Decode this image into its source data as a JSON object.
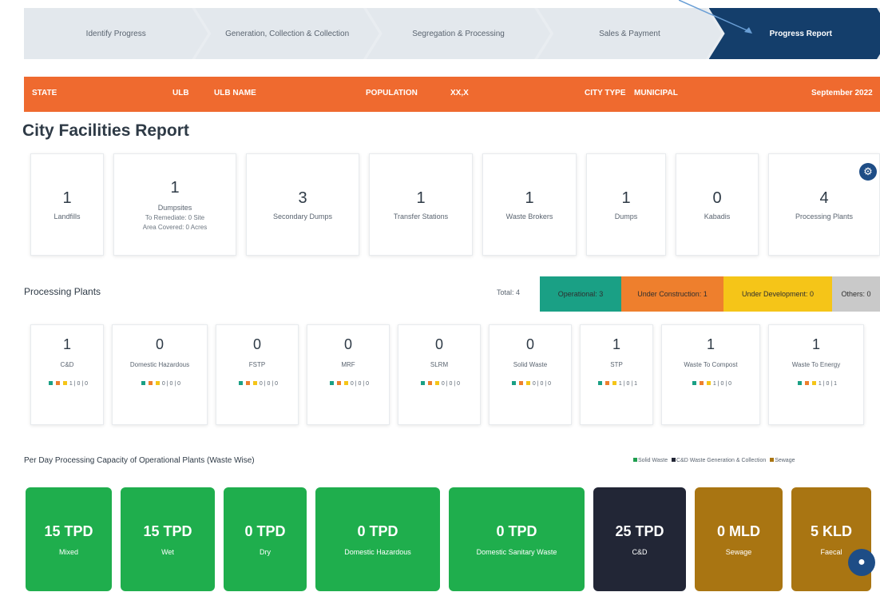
{
  "stepper": {
    "steps": [
      {
        "label": "Identify Progress"
      },
      {
        "label": "Generation, Collection & Collection"
      },
      {
        "label": "Segregation & Processing"
      },
      {
        "label": "Sales & Payment"
      },
      {
        "label": "Progress Report"
      }
    ],
    "active_index": 4
  },
  "banner": {
    "state": "STATE",
    "ulb_label": "ULB",
    "ulb_value": "ULB NAME",
    "population_label": "POPULATION",
    "population_value": "XX,X",
    "city_label": "CITY TYPE",
    "city_value": "MUNICIPAL",
    "month": "September 2022"
  },
  "page_title": "City Facilities Report",
  "facilities": [
    {
      "num": "1",
      "label": "Landfills"
    },
    {
      "num": "1",
      "label": "Dumpsites",
      "sub1": "To Remediate: 0 Site",
      "sub2": "Area Covered: 0 Acres"
    },
    {
      "num": "3",
      "label": "Secondary Dumps"
    },
    {
      "num": "1",
      "label": "Transfer Stations"
    },
    {
      "num": "1",
      "label": "Waste Brokers"
    },
    {
      "num": "1",
      "label": "Dumps"
    },
    {
      "num": "0",
      "label": "Kabadis"
    },
    {
      "num": "4",
      "label": "Processing Plants"
    }
  ],
  "gear_icon": "gear-icon",
  "processing": {
    "title": "Processing Plants",
    "total": "Total: 4",
    "filters": [
      {
        "label": "Operational: 3",
        "color": "#1aa085"
      },
      {
        "label": "Under Construction: 1",
        "color": "#ee7f2d"
      },
      {
        "label": "Under Development: 0",
        "color": "#f5c518"
      },
      {
        "label": "Others: 0",
        "color": "#c9c9c9"
      }
    ],
    "plants": [
      {
        "num": "1",
        "label": "C&D",
        "stat": "1 | 0 | 0"
      },
      {
        "num": "0",
        "label": "Domestic Hazardous",
        "stat": "0 | 0 | 0"
      },
      {
        "num": "0",
        "label": "FSTP",
        "stat": "0 | 0 | 0"
      },
      {
        "num": "0",
        "label": "MRF",
        "stat": "0 | 0 | 0"
      },
      {
        "num": "0",
        "label": "SLRM",
        "stat": "0 | 0 | 0"
      },
      {
        "num": "0",
        "label": "Solid Waste",
        "stat": "0 | 0 | 0"
      },
      {
        "num": "1",
        "label": "STP",
        "stat": "1 | 0 | 1"
      },
      {
        "num": "1",
        "label": "Waste To Compost",
        "stat": "1 | 0 | 0"
      },
      {
        "num": "1",
        "label": "Waste To Energy",
        "stat": "1 | 0 | 1"
      }
    ],
    "status_colors": [
      "#1aa085",
      "#ee7f2d",
      "#f5c518"
    ]
  },
  "capacity": {
    "title": "Per Day Processing Capacity of Operational Plants (Waste Wise)",
    "legend": [
      {
        "label": "Solid Waste",
        "color": "#1f9e4f"
      },
      {
        "label": "C&D Waste Generation & Collection",
        "color": "#222636"
      },
      {
        "label": "Sewage",
        "color": "#a97512"
      }
    ],
    "cards": [
      {
        "value": "15 TPD",
        "label": "Mixed",
        "color": "#1fae4d"
      },
      {
        "value": "15 TPD",
        "label": "Wet",
        "color": "#1fae4d"
      },
      {
        "value": "0 TPD",
        "label": "Dry",
        "color": "#1fae4d"
      },
      {
        "value": "0 TPD",
        "label": "Domestic Hazardous",
        "color": "#1fae4d"
      },
      {
        "value": "0 TPD",
        "label": "Domestic Sanitary Waste",
        "color": "#1fae4d"
      },
      {
        "value": "25 TPD",
        "label": "C&D",
        "color": "#222636"
      },
      {
        "value": "0 MLD",
        "label": "Sewage",
        "color": "#a97512"
      },
      {
        "value": "5 KLD",
        "label": "Faecal",
        "color": "#a97512"
      }
    ]
  },
  "chat_icon": "chat-icon"
}
